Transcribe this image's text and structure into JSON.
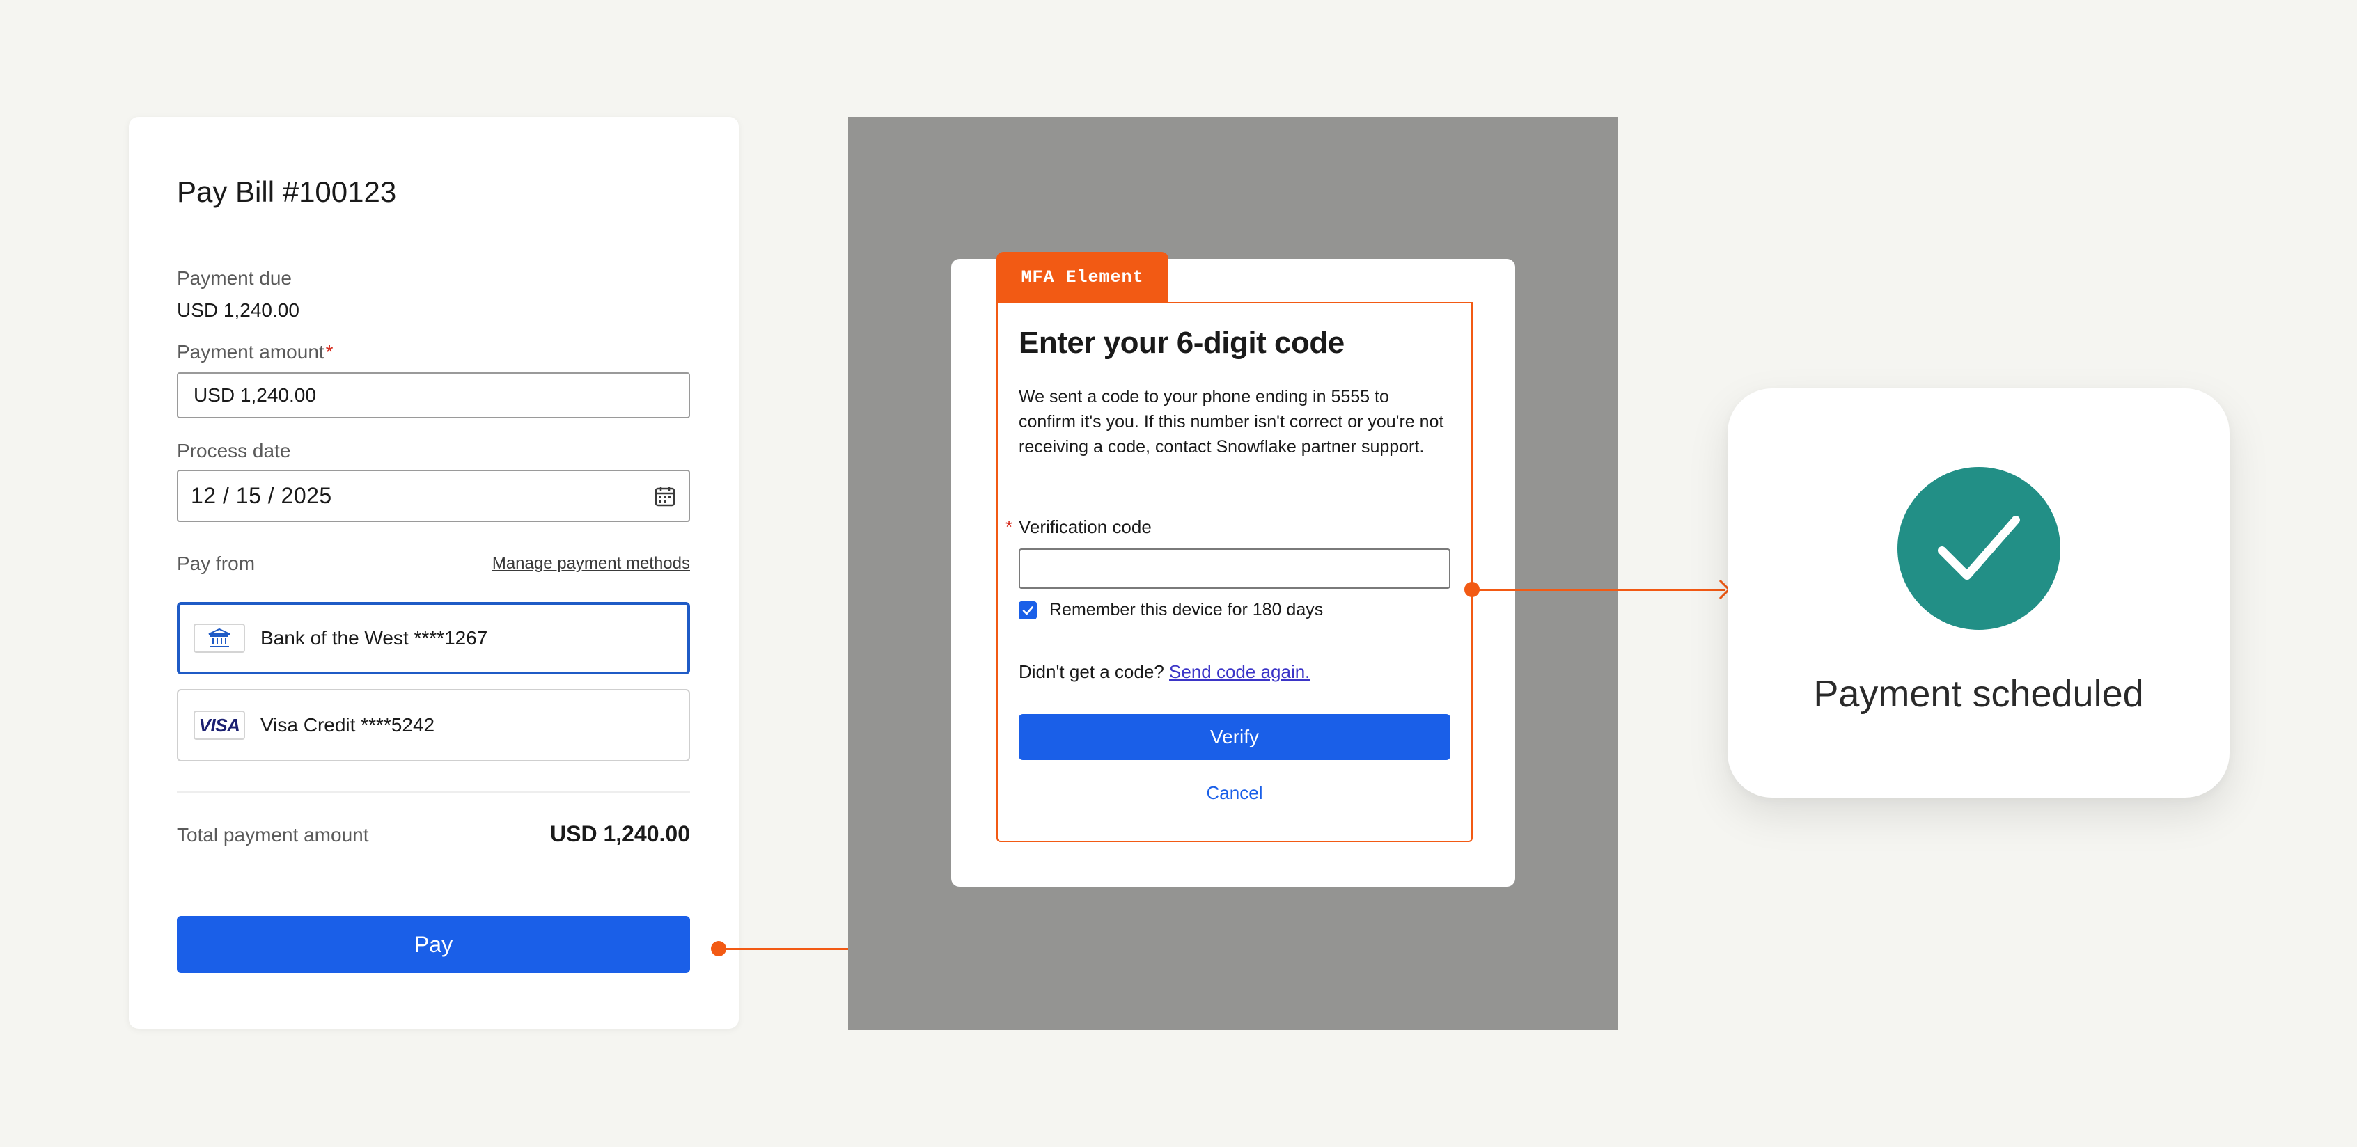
{
  "pay_bill": {
    "title": "Pay Bill #100123",
    "payment_due_label": "Payment due",
    "payment_due_value": "USD 1,240.00",
    "payment_amount_label": "Payment amount",
    "required_mark": "*",
    "payment_amount_value": "USD 1,240.00",
    "process_date_label": "Process date",
    "process_date_value": "12 / 15 / 2025",
    "pay_from_label": "Pay from",
    "manage_link": "Manage payment methods",
    "methods": [
      {
        "label": "Bank of the West ****1267",
        "icon": "bank-icon",
        "selected": true
      },
      {
        "label": "Visa Credit ****5242",
        "icon": "visa-icon",
        "badge": "VISA",
        "selected": false
      }
    ],
    "total_label": "Total payment amount",
    "total_value": "USD 1,240.00",
    "pay_button": "Pay"
  },
  "mfa": {
    "tag": "MFA Element",
    "title": "Enter your 6-digit code",
    "description": "We sent a code to your phone ending in 5555 to confirm it's you. If this number isn't correct or you're not receiving a code, contact Snowflake partner support.",
    "code_label": "Verification code",
    "required_mark": "*",
    "code_value": "",
    "remember_label": "Remember this device for 180 days",
    "remember_checked": true,
    "resend_prompt": "Didn't get a code?",
    "resend_link": "Send code again.",
    "verify_button": "Verify",
    "cancel_link": "Cancel"
  },
  "success": {
    "message": "Payment scheduled"
  },
  "colors": {
    "accent_orange": "#f25a14",
    "primary_blue": "#1a5fe8",
    "success_teal": "#228f86",
    "overlay_grey": "#949492"
  }
}
